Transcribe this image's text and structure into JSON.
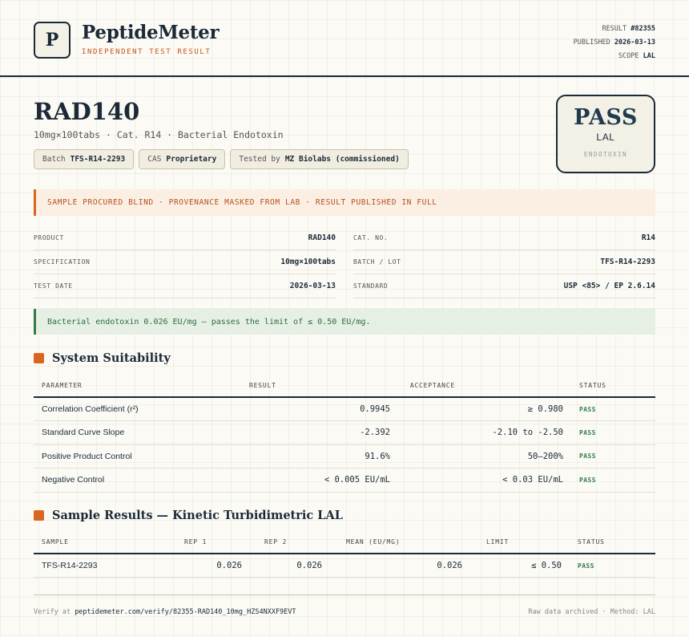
{
  "header": {
    "logo_letter": "P",
    "brand": "PeptideMeter",
    "tagline": "INDEPENDENT TEST RESULT",
    "meta": [
      {
        "label": "RESULT",
        "value": "#82355"
      },
      {
        "label": "PUBLISHED",
        "value": "2026-03-13"
      },
      {
        "label": "SCOPE",
        "value": "LAL"
      }
    ]
  },
  "product": {
    "title": "RAD140",
    "subtitle": "10mg×100tabs · Cat. R14 · Bacterial Endotoxin",
    "chips": [
      {
        "label": "Batch",
        "value": "TFS-R14-2293"
      },
      {
        "label": "CAS",
        "value": "Proprietary"
      },
      {
        "label": "Tested by",
        "value": "MZ Biolabs (commissioned)"
      }
    ]
  },
  "stamp": {
    "verdict": "PASS",
    "scope": "LAL",
    "category": "ENDOTOXIN"
  },
  "notice": "SAMPLE PROCURED BLIND · PROVENANCE MASKED FROM LAB · RESULT PUBLISHED IN FULL",
  "specs_left": [
    {
      "label": "PRODUCT",
      "value": "RAD140"
    },
    {
      "label": "SPECIFICATION",
      "value": "10mg×100tabs"
    },
    {
      "label": "TEST DATE",
      "value": "2026-03-13"
    }
  ],
  "specs_right": [
    {
      "label": "CAT. NO.",
      "value": "R14"
    },
    {
      "label": "BATCH / LOT",
      "value": "TFS-R14-2293"
    },
    {
      "label": "STANDARD",
      "value": "USP <85> / EP 2.6.14"
    }
  ],
  "conclusion": "Bacterial endotoxin 0.026 EU/mg — passes the limit of ≤ 0.50 EU/mg.",
  "suitability": {
    "title": "System Suitability",
    "columns": [
      "PARAMETER",
      "RESULT",
      "ACCEPTANCE",
      "STATUS"
    ],
    "rows": [
      {
        "parameter": "Correlation Coefficient (r²)",
        "result": "0.9945",
        "acceptance": "≥ 0.980",
        "status": "PASS"
      },
      {
        "parameter": "Standard Curve Slope",
        "result": "-2.392",
        "acceptance": "-2.10 to -2.50",
        "status": "PASS"
      },
      {
        "parameter": "Positive Product Control",
        "result": "91.6%",
        "acceptance": "50–200%",
        "status": "PASS"
      },
      {
        "parameter": "Negative Control",
        "result": "< 0.005 EU/mL",
        "acceptance": "< 0.03 EU/mL",
        "status": "PASS"
      }
    ]
  },
  "samples": {
    "title": "Sample Results — Kinetic Turbidimetric LAL",
    "columns": [
      "SAMPLE",
      "REP 1",
      "REP 2",
      "MEAN (EU/MG)",
      "LIMIT",
      "STATUS"
    ],
    "rows": [
      {
        "sample": "TFS-R14-2293",
        "rep1": "0.026",
        "rep2": "0.026",
        "mean": "0.026",
        "limit": "≤ 0.50",
        "status": "PASS"
      }
    ]
  },
  "footer": {
    "verify_label": "Verify at",
    "verify_url": "peptidemeter.com/verify/82355-RAD140_10mg_HZS4NXXF9EVT",
    "right": "Raw data archived · Method: LAL"
  },
  "colors": {
    "ink": "#1c2a38",
    "accent": "#d9661f",
    "pass": "#2e7d4a"
  }
}
